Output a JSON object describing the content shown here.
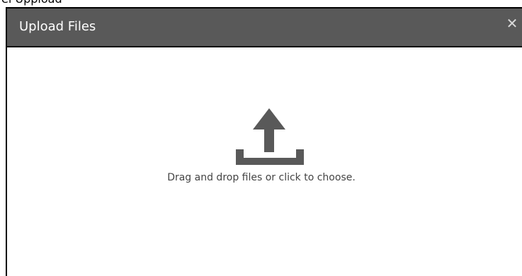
{
  "background_text": "el Uppload",
  "dialog": {
    "title": "Upload Files",
    "close_label": "✕",
    "dropzone_text": "Drag and drop files or click to choose.",
    "upload_icon": "upload-icon"
  },
  "colors": {
    "header_bg": "#595959",
    "header_text": "#ffffff",
    "icon": "#595959",
    "body_text": "#444444"
  }
}
